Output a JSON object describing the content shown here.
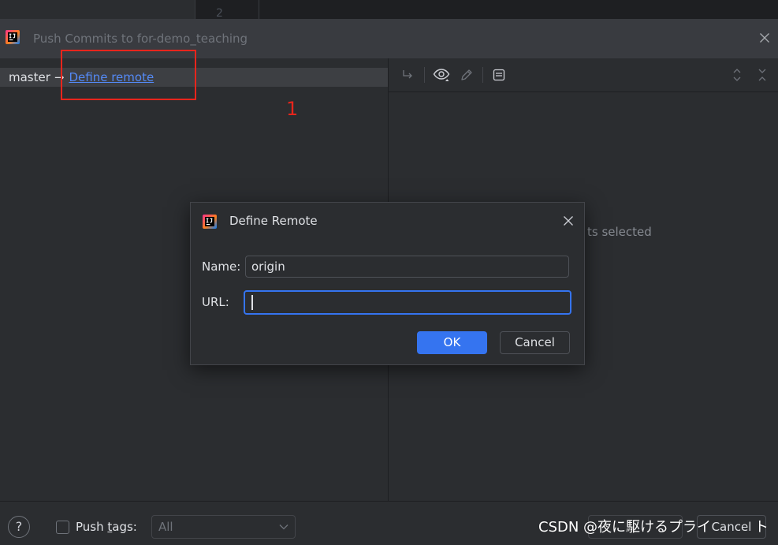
{
  "background_editor": {
    "line_number": "2"
  },
  "push_dialog": {
    "title": "Push Commits to for-demo_teaching",
    "app_icon": "intellij-idea-icon",
    "close_icon": "close-icon",
    "branch_row": {
      "local_branch": "master",
      "arrow": "→",
      "define_remote_link": "Define remote"
    },
    "details_toolbar": {
      "icons": [
        "show-diff-icon",
        "eye-icon",
        "edit-source-icon",
        "preview-icon",
        "expand-all-icon",
        "collapse-all-icon"
      ]
    },
    "details_empty_text": "ts selected",
    "footer": {
      "help_label": "?",
      "push_tags_prefix": "Push ",
      "push_tags_mnemonic": "t",
      "push_tags_suffix": "ags:",
      "push_tags_checked": false,
      "push_tags_mode": "All",
      "cancel_label": "Cancel"
    }
  },
  "define_remote_dialog": {
    "title": "Define Remote",
    "name_label": "Name:",
    "name_value": "origin",
    "url_label": "URL:",
    "url_value": "",
    "ok_label": "OK",
    "cancel_label": "Cancel"
  },
  "annotation": {
    "label": "1",
    "color": "#e8251c"
  },
  "watermark": {
    "text_start": "CSDN @夜に駆けるプライ",
    "text_end": "ト"
  },
  "colors": {
    "accent": "#3574f0",
    "link": "#548af7",
    "text": "#dfe1e5",
    "muted": "#6f737a",
    "panel": "#2b2d30"
  }
}
